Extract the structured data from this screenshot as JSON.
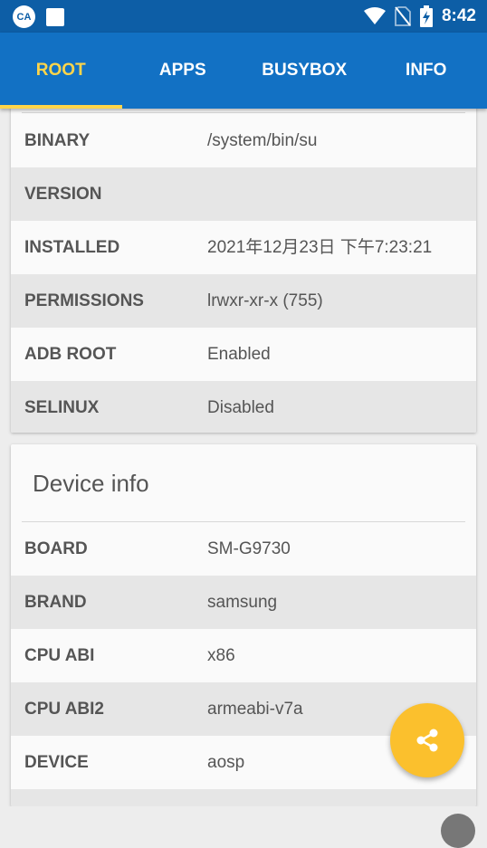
{
  "status_bar": {
    "app_badge": "CA",
    "time": "8:42"
  },
  "tabs": [
    {
      "label": "ROOT"
    },
    {
      "label": "APPS"
    },
    {
      "label": "BUSYBOX"
    },
    {
      "label": "INFO"
    }
  ],
  "root_card": {
    "rows": [
      {
        "key": "BINARY",
        "value": "/system/bin/su"
      },
      {
        "key": "VERSION",
        "value": ""
      },
      {
        "key": "INSTALLED",
        "value": "2021年12月23日 下午7:23:21"
      },
      {
        "key": "PERMISSIONS",
        "value": "lrwxr-xr-x (755)"
      },
      {
        "key": "ADB ROOT",
        "value": "Enabled"
      },
      {
        "key": "SELINUX",
        "value": "Disabled"
      }
    ]
  },
  "device_card": {
    "title": "Device info",
    "rows": [
      {
        "key": "BOARD",
        "value": "SM-G9730"
      },
      {
        "key": "BRAND",
        "value": "samsung"
      },
      {
        "key": "CPU ABI",
        "value": "x86"
      },
      {
        "key": "CPU ABI2",
        "value": "armeabi-v7a"
      },
      {
        "key": "DEVICE",
        "value": "aosp"
      }
    ]
  },
  "colors": {
    "status_bar": "#0d5ea6",
    "tab_bar": "#1271c4",
    "accent": "#ffd54a",
    "fab": "#fbc02d"
  },
  "icons": {
    "fab": "share-icon"
  }
}
